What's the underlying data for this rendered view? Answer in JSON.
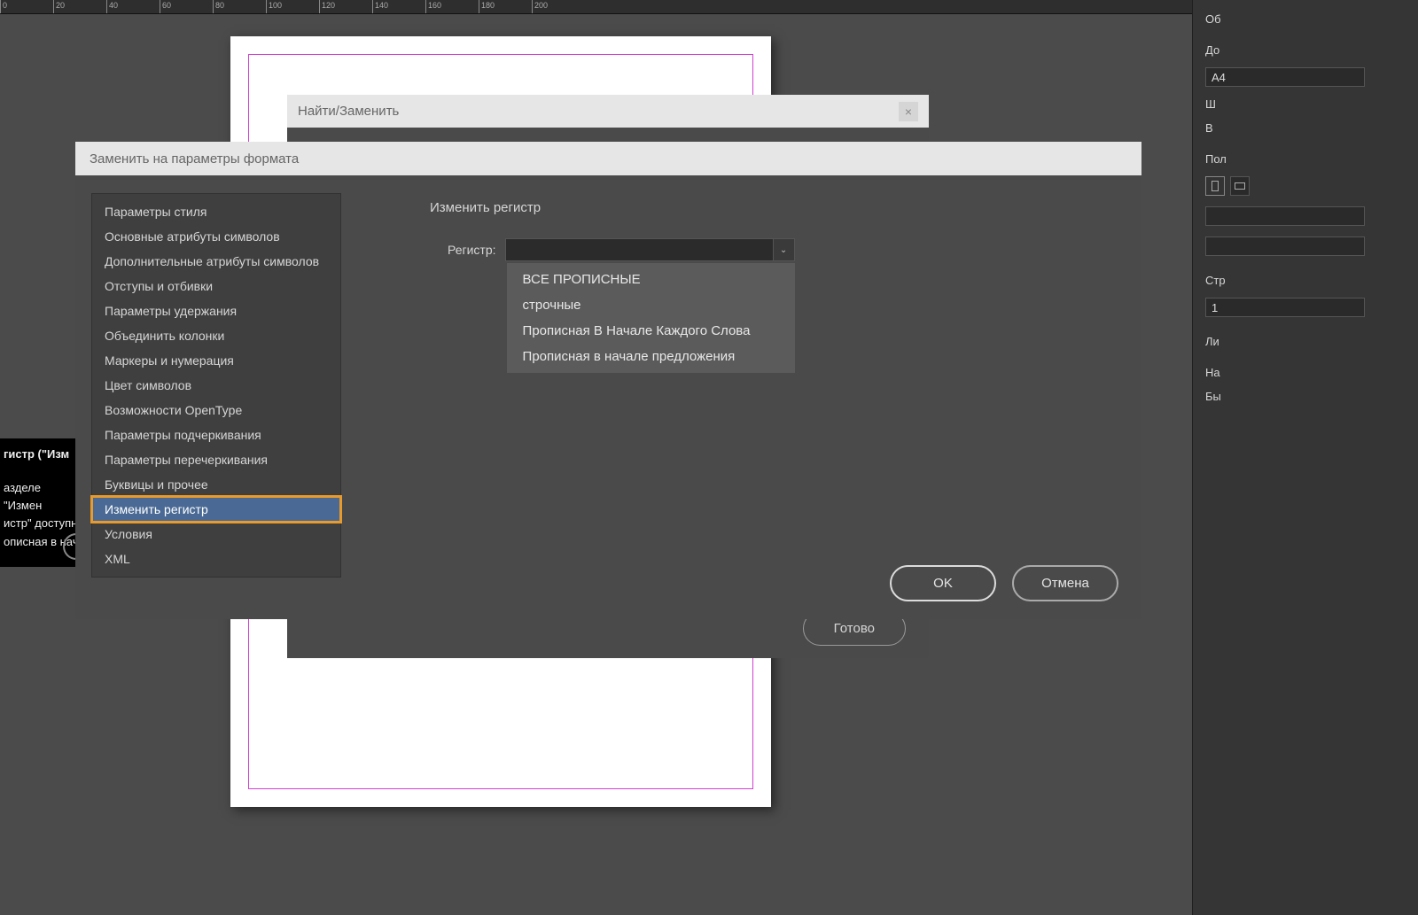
{
  "ruler_marks": [
    "0",
    "20",
    "40",
    "60",
    "80",
    "100",
    "120",
    "140",
    "160",
    "180",
    "200"
  ],
  "right_panel": {
    "l1": "Об",
    "l_doc": "До",
    "doc_preset": "А4",
    "l_w": "Ш",
    "l_h": "В",
    "l_margins": "Пол",
    "l_pages": "Стр",
    "pages_value": "1",
    "l_lines": "Ли",
    "l_name": "На",
    "l_bleed": "Бы"
  },
  "note": {
    "title": "гистр (\"Изм",
    "line1": "азделе \"Измен",
    "line2": "истр\" доступн",
    "line3": "описная в нач"
  },
  "find_dialog": {
    "title": "Найти/Заменить",
    "close": "×",
    "done": "Готово"
  },
  "format_dialog": {
    "title": "Заменить на параметры формата",
    "categories": [
      "Параметры стиля",
      "Основные атрибуты символов",
      "Дополнительные атрибуты символов",
      "Отступы и отбивки",
      "Параметры удержания",
      "Объединить колонки",
      "Маркеры и нумерация",
      "Цвет символов",
      "Возможности OpenType",
      "Параметры подчеркивания",
      "Параметры перечеркивания",
      "Буквицы и прочее",
      "Изменить регистр",
      "Условия",
      "XML"
    ],
    "selected_index": 12,
    "detail_title": "Изменить регистр",
    "register_label": "Регистр:",
    "dd_arrow": "⌄",
    "dd_options": [
      "ВСЕ ПРОПИСНЫЕ",
      "строчные",
      "Прописная В Начале Каждого Слова",
      "Прописная в начале предложения"
    ],
    "ok": "OK",
    "cancel": "Отмена"
  }
}
